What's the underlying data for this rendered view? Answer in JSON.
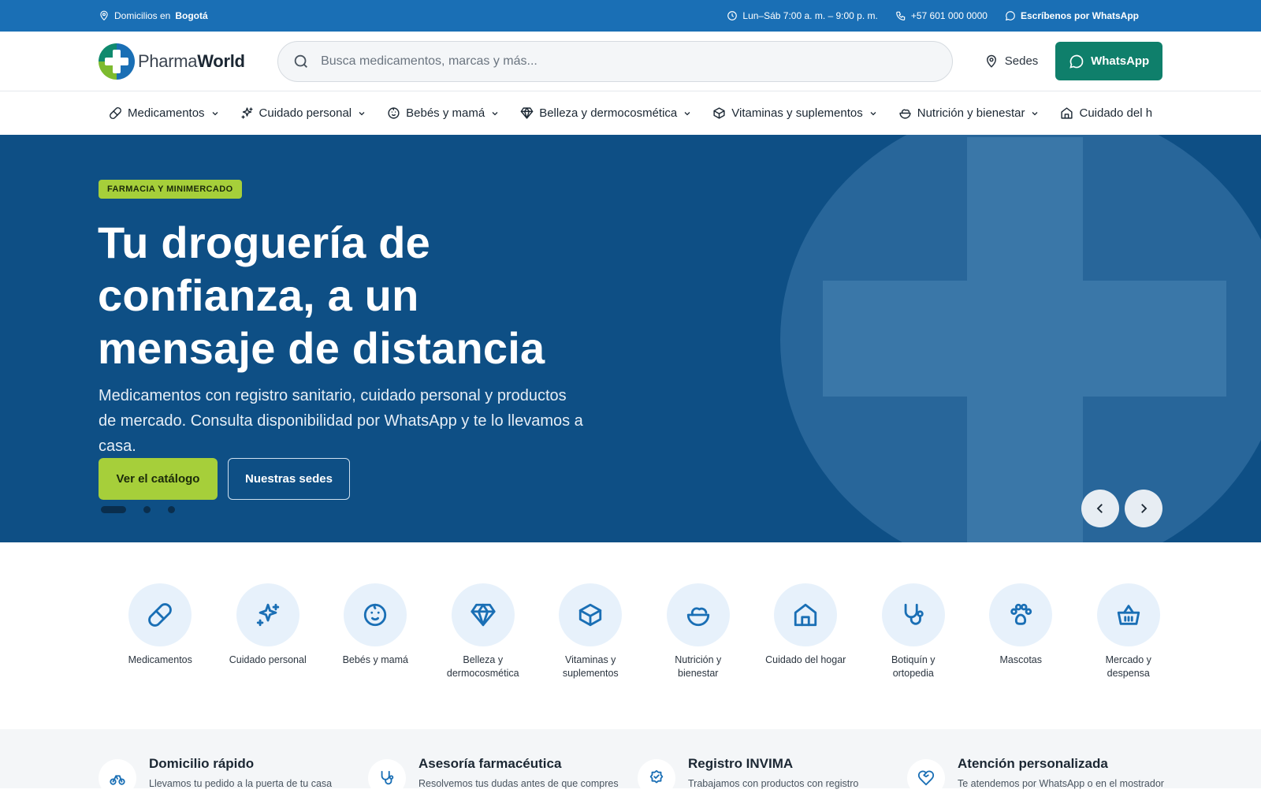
{
  "topbar": {
    "location_prefix": "Domicilios en",
    "location_city": "Bogotá",
    "hours": "Lun–Sáb 7:00 a. m. – 9:00 p. m.",
    "phone": "+57 601 000 0000",
    "whatsapp_link": "Escríbenos por WhatsApp"
  },
  "header": {
    "logo_part1": "Pharma",
    "logo_part2": "World",
    "search_placeholder": "Busca medicamentos, marcas y más...",
    "sedes_label": "Sedes",
    "whatsapp_button": "WhatsApp"
  },
  "nav": {
    "items": [
      {
        "label": "Medicamentos",
        "icon": "pill-icon"
      },
      {
        "label": "Cuidado personal",
        "icon": "sparkles-icon"
      },
      {
        "label": "Bebés y mamá",
        "icon": "baby-icon"
      },
      {
        "label": "Belleza y dermocosmética",
        "icon": "gem-icon"
      },
      {
        "label": "Vitaminas y suplementos",
        "icon": "box-icon"
      },
      {
        "label": "Nutrición y bienestar",
        "icon": "salad-icon"
      },
      {
        "label": "Cuidado del h",
        "icon": "home-icon"
      }
    ]
  },
  "hero": {
    "badge": "FARMACIA Y MINIMERCADO",
    "title": "Tu droguería de confianza, a un mensaje de distancia",
    "subtitle": "Medicamentos con registro sanitario, cuidado personal y productos de mercado. Consulta disponibilidad por WhatsApp y te lo llevamos a casa.",
    "primary_button": "Ver el catálogo",
    "secondary_button": "Nuestras sedes",
    "slide_count": 3,
    "active_slide": 1
  },
  "categories": [
    {
      "label": "Medicamentos",
      "icon": "pill-icon"
    },
    {
      "label": "Cuidado personal",
      "icon": "sparkles-icon"
    },
    {
      "label": "Bebés y mamá",
      "icon": "baby-icon"
    },
    {
      "label": "Belleza y dermocosmética",
      "icon": "gem-icon"
    },
    {
      "label": "Vitaminas y suplementos",
      "icon": "box-icon"
    },
    {
      "label": "Nutrición y bienestar",
      "icon": "salad-icon"
    },
    {
      "label": "Cuidado del hogar",
      "icon": "home-icon"
    },
    {
      "label": "Botiquín y ortopedia",
      "icon": "stethoscope-icon"
    },
    {
      "label": "Mascotas",
      "icon": "paw-icon"
    },
    {
      "label": "Mercado y despensa",
      "icon": "basket-icon"
    }
  ],
  "features": [
    {
      "title": "Domicilio rápido",
      "desc": "Llevamos tu pedido a la puerta de tu casa",
      "icon": "bike-icon"
    },
    {
      "title": "Asesoría farmacéutica",
      "desc": "Resolvemos tus dudas antes de que compres",
      "icon": "stethoscope-icon"
    },
    {
      "title": "Registro INVIMA",
      "desc": "Trabajamos con productos con registro",
      "icon": "badge-check-icon"
    },
    {
      "title": "Atención personalizada",
      "desc": "Te atendemos por WhatsApp o en el mostrador",
      "icon": "heart-handshake-icon"
    }
  ],
  "colors": {
    "topbar": "#1a6fb5",
    "hero_bg": "#0e4f85",
    "accent_green": "#a6cf3a",
    "whatsapp_green": "#0f7f6b"
  }
}
